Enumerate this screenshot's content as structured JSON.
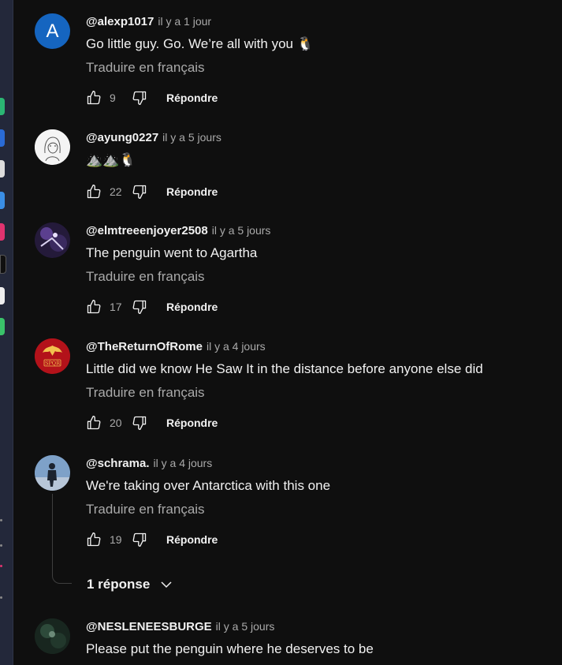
{
  "colors": {
    "background": "#0f0f0f",
    "text": "#f1f1f1",
    "muted": "#aaaaaa",
    "avatar_blue": "#1565c0"
  },
  "dock_icons": [
    {
      "color": "#2bb673"
    },
    {
      "color": "#2a6bd6"
    },
    {
      "color": "#dddddd"
    },
    {
      "color": "#3a8ee6"
    },
    {
      "color": "#e0336f"
    },
    {
      "color": "#101010"
    },
    {
      "color": "#eeeeee"
    },
    {
      "color": "#3ac26a"
    }
  ],
  "comments": [
    {
      "author": "@alexp1017",
      "time": "il y a 1 jour",
      "text": "Go little guy. Go. We’re all with you 🐧",
      "translate": "Traduire en français",
      "likes": "9",
      "reply": "Répondre",
      "avatar": "A"
    },
    {
      "author": "@ayung0227",
      "time": "il y a 5 jours",
      "text": "⛰️⛰️🐧",
      "likes": "22",
      "reply": "Répondre",
      "avatar": "sketch"
    },
    {
      "author": "@elmtreeenjoyer2508",
      "time": "il y a 5 jours",
      "text": "The penguin went to Agartha",
      "translate": "Traduire en français",
      "likes": "17",
      "reply": "Répondre",
      "avatar": "dark-purple"
    },
    {
      "author": "@TheReturnOfRome",
      "time": "il y a 4 jours",
      "text": "Little did we know He Saw It in the distance before anyone else did",
      "translate": "Traduire en français",
      "likes": "20",
      "reply": "Répondre",
      "avatar": "spqr"
    },
    {
      "author": "@schrama.",
      "time": "il y a 4 jours",
      "text": "We're taking over Antarctica with this one",
      "translate": "Traduire en français",
      "likes": "19",
      "reply": "Répondre",
      "avatar": "blue-figure"
    },
    {
      "author": "@NESLENEESBURGE",
      "time": "il y a 5 jours",
      "text": "Please put the penguin where he deserves to be",
      "avatar": "dark-green"
    }
  ],
  "replies_toggle": {
    "label": "1 réponse"
  },
  "avatar_spqr_text": "SPQR"
}
